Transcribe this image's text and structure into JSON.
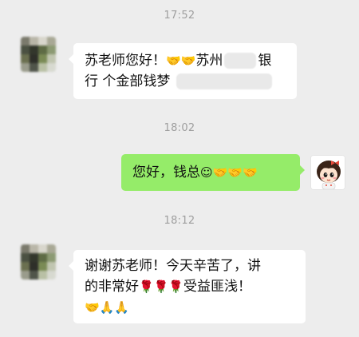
{
  "colors": {
    "background": "#ededed",
    "sent_bubble": "#95ec69",
    "received_bubble": "#ffffff",
    "timestamp_text": "#9e9e9e"
  },
  "messages": [
    {
      "time": "17:52",
      "sender": "other",
      "line1_a": "苏老师您好！",
      "line1_emoji": "🤝🤝",
      "line1_b": "苏州",
      "line1_c": "银",
      "line2": "行 个金部钱梦"
    },
    {
      "time": "18:02",
      "sender": "self",
      "text": "您好，钱总",
      "emoji": "☺🤝🤝🤝"
    },
    {
      "time": "18:12",
      "sender": "other",
      "line1": "谢谢苏老师！今天辛苦了，讲",
      "line2_a": "的非常好",
      "line2_emoji": "🌹🌹🌹",
      "line2_b": "受益匪浅！",
      "line3_emoji": "🤝🙏🙏"
    }
  ]
}
